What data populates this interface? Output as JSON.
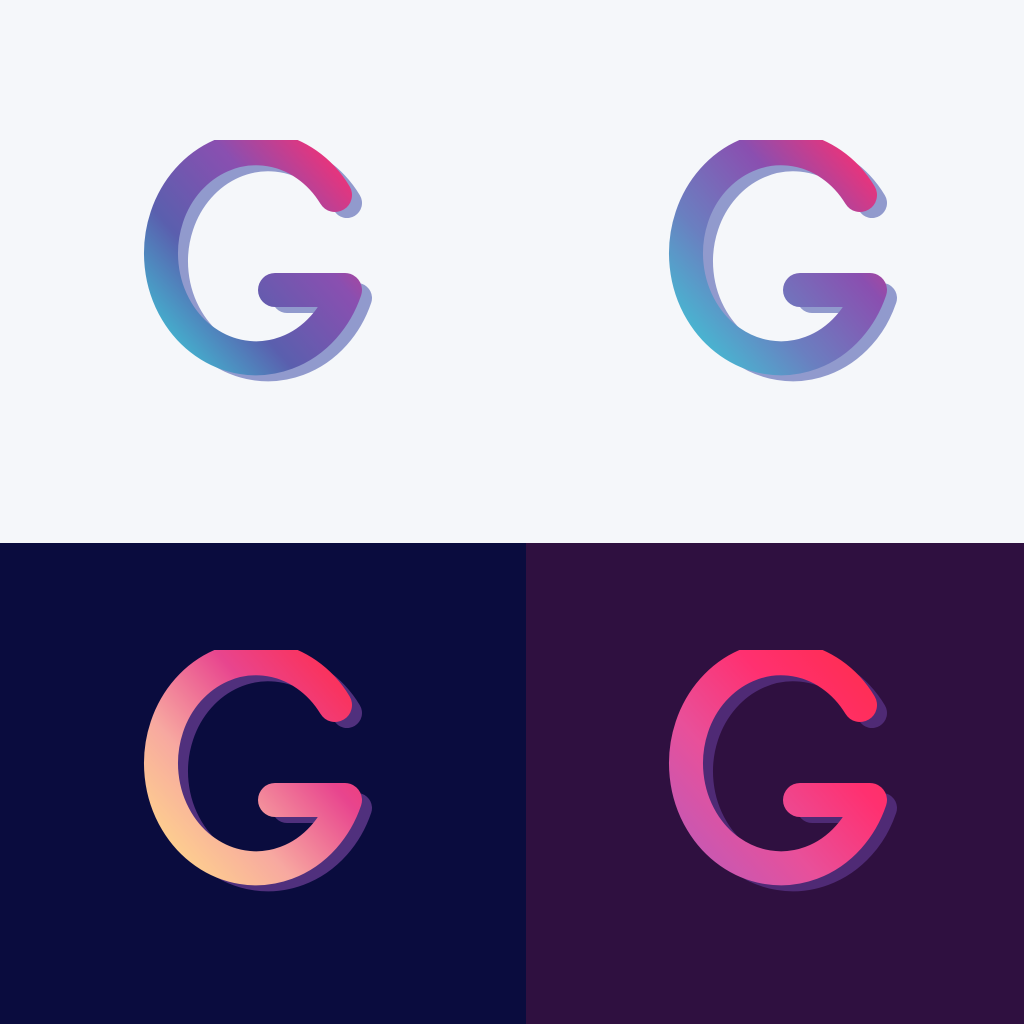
{
  "panels": [
    {
      "id": "light-a",
      "background": "#F5F7FA",
      "gradient": [
        "#3EC6D6",
        "#5A5FAE",
        "#8A4FB0",
        "#FF2D6F"
      ],
      "inner_shade": "#3E4FA8"
    },
    {
      "id": "light-b",
      "background": "#F5F7FA",
      "gradient": [
        "#3EC6D6",
        "#6A7FC0",
        "#8A4FB0",
        "#FF2D6F"
      ],
      "inner_shade": "#3E4FA8"
    },
    {
      "id": "navy",
      "background": "#0A0C3E",
      "gradient": [
        "#FFD98A",
        "#F7A8A0",
        "#E8458E",
        "#FF2D4F"
      ],
      "inner_shade": "#8A4FB0"
    },
    {
      "id": "plum",
      "background": "#2F1040",
      "gradient": [
        "#C05AB8",
        "#E8509A",
        "#FF3070",
        "#FF2D4F"
      ],
      "inner_shade": "#6A3FA0"
    }
  ]
}
